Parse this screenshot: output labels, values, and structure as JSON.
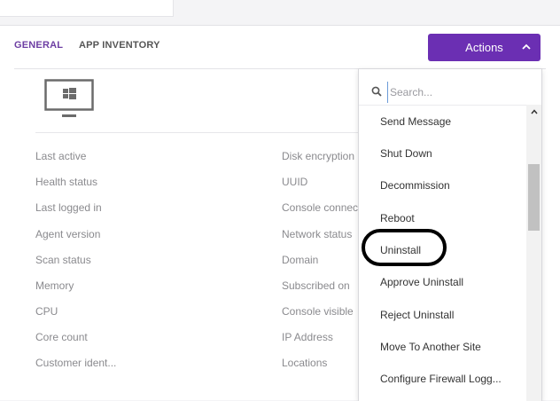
{
  "tabs": [
    {
      "label": "GENERAL",
      "active": true
    },
    {
      "label": "APP INVENTORY",
      "active": false
    }
  ],
  "actions_button": {
    "label": "Actions"
  },
  "device_icon": "windows-monitor-icon",
  "details": {
    "left_labels": [
      "Last active",
      "Health status",
      "Last logged in",
      "Agent version",
      "Scan status",
      "Memory",
      "CPU",
      "Core count",
      "Customer ident..."
    ],
    "right_labels": [
      "Disk encryption",
      "UUID",
      "Console connected",
      "Network status",
      "Domain",
      "Subscribed on",
      "Console visible",
      "IP Address",
      "Locations"
    ]
  },
  "dropdown": {
    "search_placeholder": "Search...",
    "items": [
      "Send Message",
      "Shut Down",
      "Decommission",
      "Reboot",
      "Uninstall",
      "Approve Uninstall",
      "Reject Uninstall",
      "Move To Another Site",
      "Configure Firewall Logg..."
    ]
  },
  "colors": {
    "accent": "#6b2fb3",
    "tab_active": "#6d3ea3",
    "label": "#8a8a8e"
  }
}
